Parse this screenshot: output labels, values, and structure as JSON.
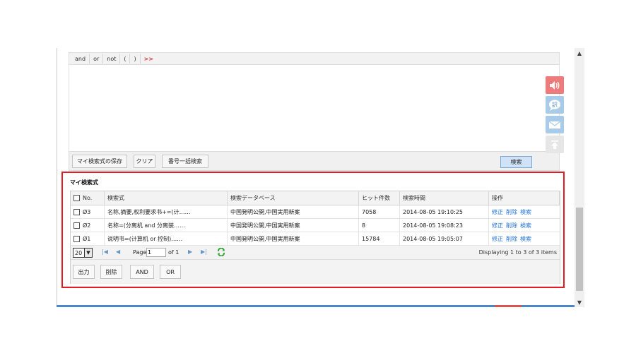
{
  "operators": [
    "and",
    "or",
    "not",
    "(",
    ")",
    ">>"
  ],
  "actions": {
    "save": "マイ検索式の保存",
    "clear": "クリア",
    "batch": "番号一括検索",
    "search": "検索"
  },
  "side_tools": [
    {
      "icon": "speaker-icon"
    },
    {
      "icon": "translate-icon",
      "label": "訳"
    },
    {
      "icon": "mail-icon"
    },
    {
      "icon": "back-to-top-icon"
    }
  ],
  "panel": {
    "title": "マイ検索式",
    "columns": [
      "No.",
      "検索式",
      "検索データベース",
      "ヒット件数",
      "検索時間",
      "操作"
    ],
    "rows": [
      {
        "no": "Ø3",
        "expr": "名称,摘要,权利要求书+=(计……",
        "db": "中国発明公開,中国実用新案",
        "hits": "7058",
        "time": "2014-08-05 19:10:25",
        "ops": [
          "修正",
          "削除",
          "検索"
        ]
      },
      {
        "no": "Ø2",
        "expr": "名称=(分离机 and 分离装……",
        "db": "中国発明公開,中国実用新案",
        "hits": "8",
        "time": "2014-08-05 19:08:23",
        "ops": [
          "修正",
          "削除",
          "検索"
        ]
      },
      {
        "no": "Ø1",
        "expr": "说明书=(计算机 or 控制)……",
        "db": "中国発明公開,中国実用新案",
        "hits": "15784",
        "time": "2014-08-05 19:05:07",
        "ops": [
          "修正",
          "削除",
          "検索"
        ]
      }
    ],
    "pager": {
      "page_size": "20",
      "page_label": "Page",
      "page_value": "1",
      "of_label": "of 1",
      "display": "Displaying 1 to 3 of 3 items"
    },
    "buttons": {
      "output": "出力",
      "delete": "削除",
      "and": "AND",
      "or": "OR"
    }
  },
  "colors": {
    "highlight": "#e31b23",
    "link": "#1d6fd6",
    "sound_button": "#ee7b7b",
    "tool_button": "#a9cbea"
  }
}
